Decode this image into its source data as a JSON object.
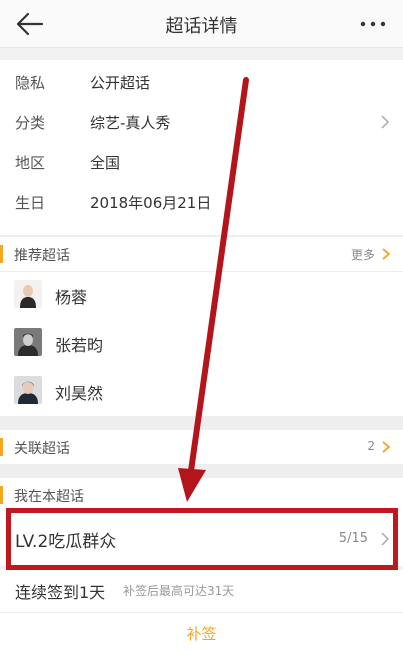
{
  "header": {
    "title": "超话详情"
  },
  "info": {
    "rows": [
      {
        "label": "隐私",
        "value": "公开超话"
      },
      {
        "label": "分类",
        "value": "综艺-真人秀"
      },
      {
        "label": "地区",
        "value": "全国"
      },
      {
        "label": "生日",
        "value": "2018年06月21日"
      }
    ]
  },
  "recommend": {
    "title": "推荐超话",
    "more": "更多",
    "items": [
      {
        "name": "杨蓉"
      },
      {
        "name": "张若昀"
      },
      {
        "name": "刘昊然"
      }
    ]
  },
  "related": {
    "title": "关联超话",
    "count": "2"
  },
  "mine": {
    "title": "我在本超话",
    "level_label": "LV.2吃瓜群众",
    "level_progress": "5/15",
    "signin_text": "连续签到1天",
    "signin_note": "补签后最高可达31天",
    "makeup_label": "补签"
  },
  "colors": {
    "accent": "#f5a623",
    "highlight": "#c0181e",
    "arrow": "#b3151a"
  },
  "icons": [
    "back-arrow-icon",
    "more-dots-icon",
    "chevron-right-icon"
  ]
}
